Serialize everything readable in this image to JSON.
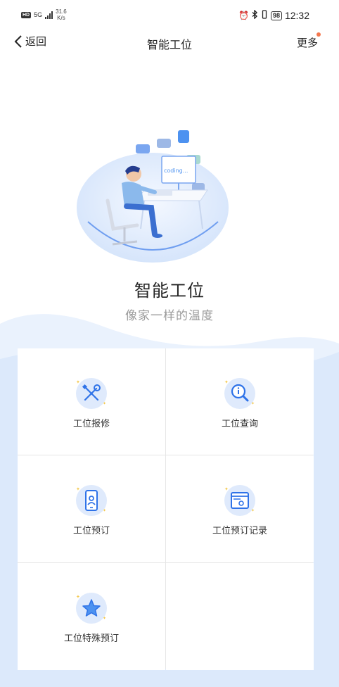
{
  "status_bar": {
    "hd": "HD",
    "network": "5G",
    "speed_value": "31.6",
    "speed_unit": "K/s",
    "battery": "98",
    "time": "12:32",
    "icons": [
      "alarm-icon",
      "bluetooth-icon",
      "vibrate-icon"
    ]
  },
  "nav": {
    "back_label": "返回",
    "title": "智能工位",
    "more_label": "更多",
    "notification_dot_color": "#f4774d"
  },
  "hero": {
    "title": "智能工位",
    "subtitle": "像家一样的温度",
    "screen_text": "coding..."
  },
  "grid": {
    "items": [
      {
        "label": "工位报修",
        "icon": "wrench-screwdriver-icon"
      },
      {
        "label": "工位查询",
        "icon": "magnifier-icon"
      },
      {
        "label": "工位预订",
        "icon": "phone-user-icon"
      },
      {
        "label": "工位预订记录",
        "icon": "screen-user-icon"
      },
      {
        "label": "工位特殊预订",
        "icon": "star-icon"
      }
    ]
  },
  "colors": {
    "accent": "#2f73e8",
    "icon_bg": "#dfeafc",
    "wave_light": "#eaf2fd",
    "wave_dark": "#d8e7fb"
  }
}
